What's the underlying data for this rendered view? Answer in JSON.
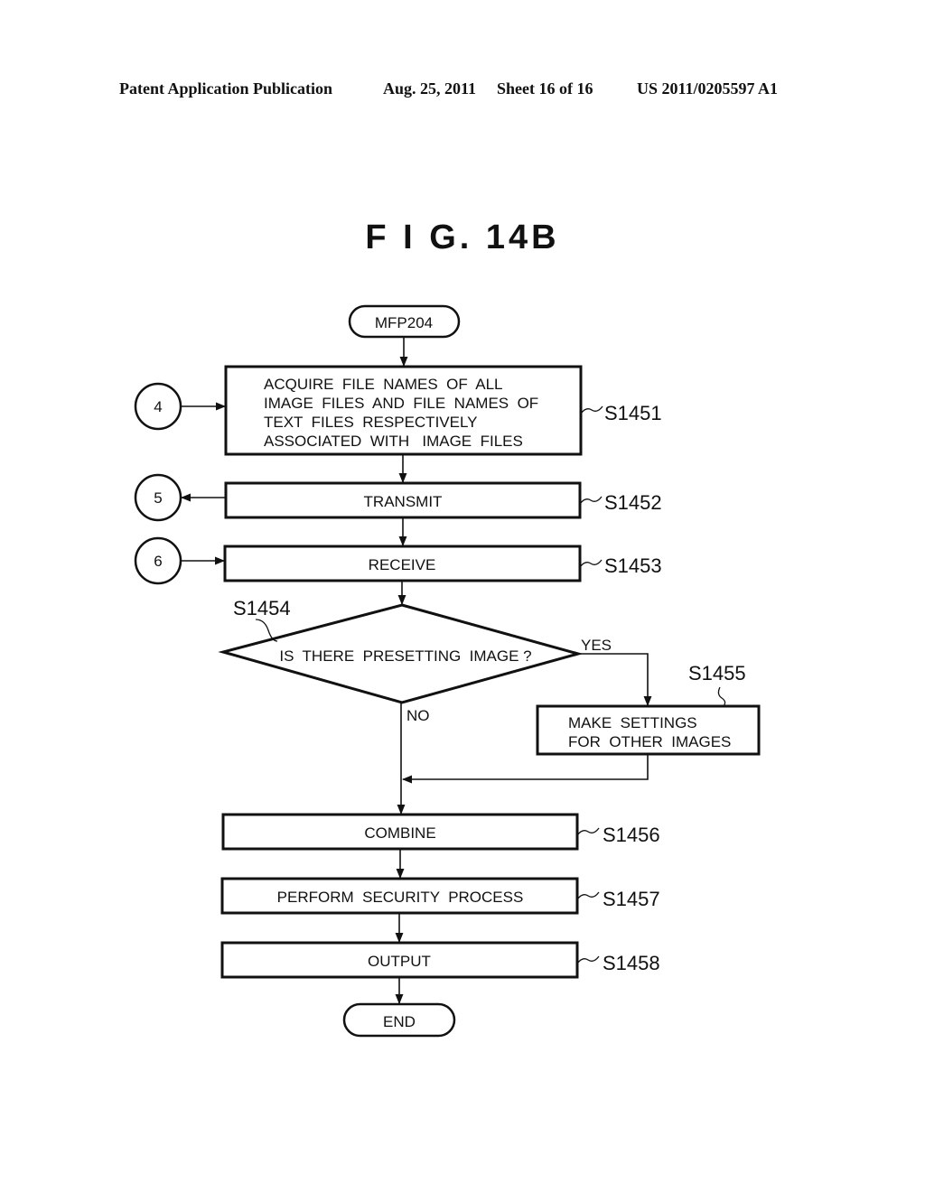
{
  "header": {
    "publication": "Patent Application Publication",
    "date": "Aug. 25, 2011",
    "sheet": "Sheet 16 of 16",
    "number": "US 2011/0205597 A1"
  },
  "figure": {
    "title": "F I G. 14B"
  },
  "flowchart": {
    "start": "MFP204",
    "end": "END",
    "connectors": [
      "4",
      "5",
      "6"
    ],
    "steps": [
      {
        "id": "S1451",
        "lines": [
          "ACQUIRE  FILE  NAMES  OF  ALL",
          "IMAGE  FILES  AND  FILE  NAMES  OF",
          "TEXT  FILES  RESPECTIVELY",
          "ASSOCIATED  WITH   IMAGE  FILES"
        ]
      },
      {
        "id": "S1452",
        "lines": [
          "TRANSMIT"
        ]
      },
      {
        "id": "S1453",
        "lines": [
          "RECEIVE"
        ]
      },
      {
        "id": "S1454",
        "lines": [
          "IS  THERE  PRESETTING  IMAGE ?"
        ],
        "type": "decision"
      },
      {
        "id": "S1455",
        "lines": [
          "MAKE  SETTINGS",
          "FOR  OTHER  IMAGES"
        ]
      },
      {
        "id": "S1456",
        "lines": [
          "COMBINE"
        ]
      },
      {
        "id": "S1457",
        "lines": [
          "PERFORM  SECURITY  PROCESS"
        ]
      },
      {
        "id": "S1458",
        "lines": [
          "OUTPUT"
        ]
      }
    ],
    "branch_yes": "YES",
    "branch_no": "NO"
  }
}
